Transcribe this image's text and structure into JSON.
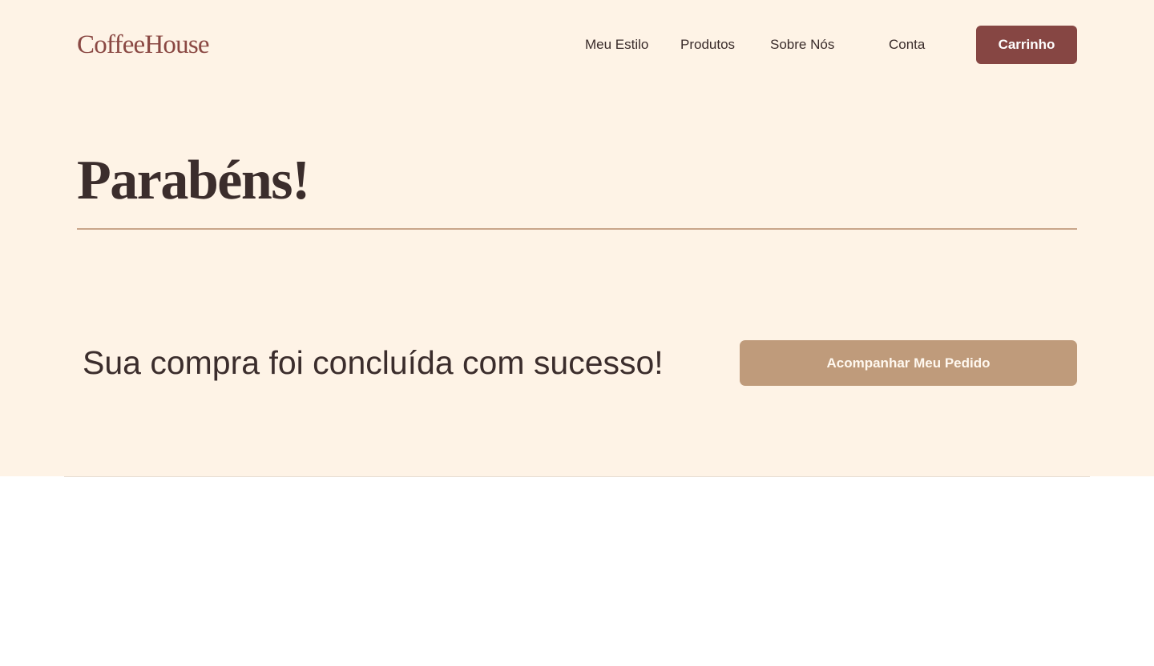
{
  "header": {
    "logo": "CoffeeHouse",
    "nav": [
      {
        "label": "Meu Estilo"
      },
      {
        "label": "Produtos"
      },
      {
        "label": "Sobre Nós"
      },
      {
        "label": "Conta"
      }
    ],
    "cart_label": "Carrinho"
  },
  "main": {
    "title": "Parabéns!",
    "message": "Sua compra foi concluída com sucesso!",
    "track_order_label": "Acompanhar Meu Pedido"
  },
  "colors": {
    "background": "#fef3e6",
    "brand": "#8a4843",
    "cart_button": "#864643",
    "track_button": "#bf9b7b",
    "text": "#3b2d2c",
    "divider": "#c9a58a"
  }
}
